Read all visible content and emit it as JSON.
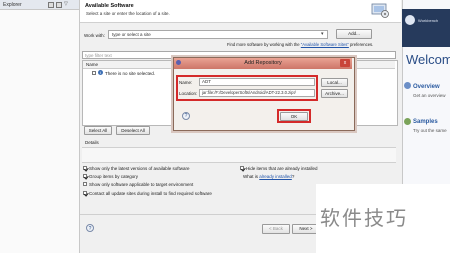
{
  "left_panel": {
    "tab_label": "Explorer"
  },
  "wizard": {
    "title": "Available Software",
    "description": "Select a site or enter the location of a site.",
    "work_with_label": "Work with:",
    "work_with_value": "type or select a site",
    "add_button": "Add...",
    "more_software_prefix": "Find more software by working with the",
    "more_software_link": "\"Available Software Sites\"",
    "more_software_suffix": "preferences.",
    "filter_placeholder": "type filter text",
    "column_name": "Name",
    "column_version": "Version",
    "no_site_message": "There is no site selected.",
    "select_all_button": "Select All",
    "deselect_all_button": "Deselect All",
    "details_label": "Details",
    "options": [
      {
        "label": "Show only the latest versions of available software",
        "checked": true
      },
      {
        "label": "Group items by category",
        "checked": true
      },
      {
        "label": "Show only software applicable to target environment",
        "checked": false
      },
      {
        "label": "Contact all update sites during install to find required software",
        "checked": true
      }
    ],
    "hide_installed_label": "Hide items that are already installed",
    "what_is_prefix": "What is",
    "what_is_link": "already installed",
    "what_is_suffix": "?",
    "back_button": "< Back",
    "next_button": "Next >",
    "help_glyph": "?"
  },
  "dialog": {
    "title": "Add Repository",
    "name_label": "Name:",
    "name_value": "ADT",
    "local_button": "Local...",
    "location_label": "Location:",
    "location_value": "jar:file:/F:/DeveloperSofts/Android/ADT-22.3.0.zip!/",
    "archive_button": "Archive...",
    "ok_button": "OK",
    "help_glyph": "?",
    "close_glyph": "x",
    "accent_color": "#d42a2a"
  },
  "welcome": {
    "title": "Welcom",
    "overview_title": "Overview",
    "overview_sub": "Get an overview",
    "samples_title": "Samples",
    "samples_sub": "Try out the same",
    "topbar_text": "Workbench"
  },
  "watermark": {
    "text": "软件技巧"
  }
}
